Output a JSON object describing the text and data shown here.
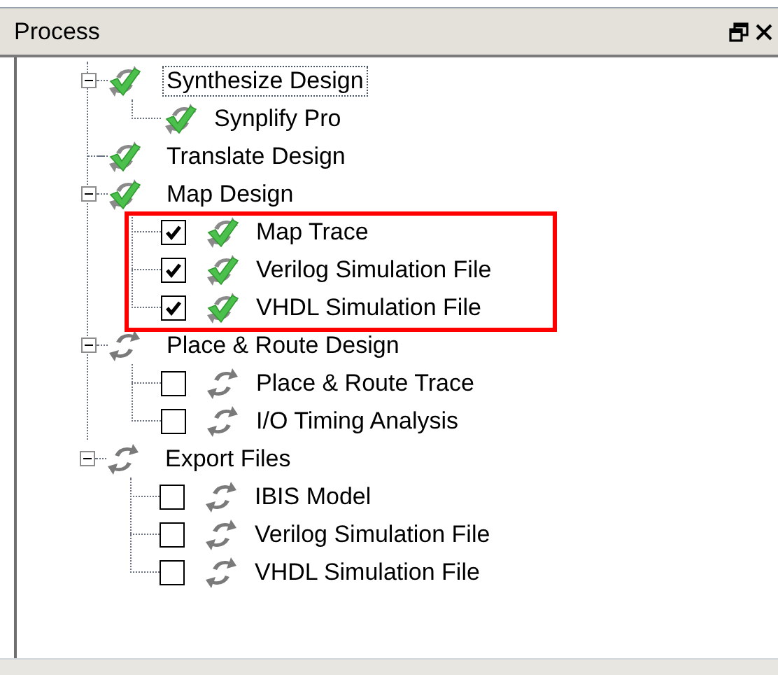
{
  "panel": {
    "title": "Process"
  },
  "tree": [
    {
      "label": "Synthesize Design",
      "completed": true,
      "selected": true,
      "expanded": true,
      "highlighted": false,
      "children": [
        {
          "kind": "tool",
          "label": "Synplify Pro",
          "completed": true,
          "selected": false
        }
      ]
    },
    {
      "label": "Translate Design",
      "completed": true,
      "selected": false,
      "highlighted": false
    },
    {
      "label": "Map Design",
      "completed": true,
      "selected": false,
      "expanded": true,
      "highlighted": true,
      "children": [
        {
          "kind": "option",
          "label": "Map Trace",
          "completed": true,
          "checked": true,
          "selected": false
        },
        {
          "kind": "option",
          "label": "Verilog Simulation File",
          "completed": true,
          "checked": true,
          "selected": false
        },
        {
          "kind": "option",
          "label": "VHDL Simulation File",
          "completed": true,
          "checked": true,
          "selected": false
        }
      ]
    },
    {
      "label": "Place & Route Design",
      "completed": false,
      "selected": false,
      "expanded": true,
      "highlighted": false,
      "children": [
        {
          "kind": "option",
          "label": "Place & Route Trace",
          "completed": false,
          "checked": false,
          "selected": false
        },
        {
          "kind": "option",
          "label": "I/O Timing Analysis",
          "completed": false,
          "checked": false,
          "selected": false
        }
      ]
    },
    {
      "label": "Export Files",
      "completed": false,
      "selected": false,
      "expanded": true,
      "highlighted": false,
      "children": [
        {
          "kind": "option",
          "label": "IBIS Model",
          "completed": false,
          "checked": false,
          "selected": false
        },
        {
          "kind": "option",
          "label": "Verilog Simulation File",
          "completed": false,
          "checked": false,
          "selected": false
        },
        {
          "kind": "option",
          "label": "VHDL Simulation File",
          "completed": false,
          "checked": false,
          "selected": false
        }
      ]
    }
  ]
}
